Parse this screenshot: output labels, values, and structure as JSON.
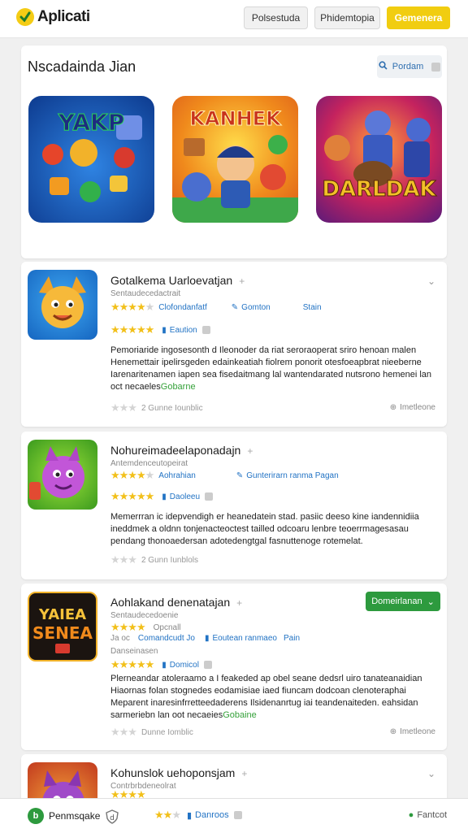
{
  "header": {
    "logo_text": "Aplicati",
    "btn1": "Polsestuda",
    "btn2": "Phidemtopia",
    "btn3": "Gemenera"
  },
  "featured": {
    "title": "Nscadainda Jian",
    "search_label": "Pordam",
    "tiles": [
      {
        "title": "YAKP"
      },
      {
        "title": "KANHEK"
      },
      {
        "title": "DARLDAK"
      }
    ]
  },
  "apps": [
    {
      "name": "Gotalkema Uarloevatjan",
      "sub": "Sentaudecedactrait",
      "meta1": "Clofondanfatf",
      "meta2": "Gomton",
      "meta3": "Stain",
      "rating_label": "Eaution",
      "description": "Pemoriaride ingosesonth d Ileonoder da riat seroraoperat sriro henoan malen Henemettair ipelirsgeden edainkeatiah fiolrem ponorit otesfoeapbrat nieeberne Iarenaritenamen iapen sea fisedaitmang lal wantendarated nutsrono hemenei lan oct necaeles",
      "desc_link": "Gobarne",
      "reviews": "2 Gunne Iounblic",
      "footer_right": "Imetleone"
    },
    {
      "name": "Nohureimadeelaponadajn",
      "sub": "Antemdenceutopeirat",
      "meta1": "Aohrahian",
      "meta2": "Gunterirarn ranma Pagan",
      "rating_label": "Daoleeu",
      "description": "Memerrran ic idepvendigh er heanedatein stad. pasiic deeso kine iandennidiia ineddmek a oldnn tonjenacteoctest tailled odcoaru lenbre teoerrmagesasau pendang thonoaedersan adotedengtgal fasnuttenoge rotemelat.",
      "reviews": "2 Gunn Iunblols"
    },
    {
      "name": "Aohlakand denenatajan",
      "sub": "Sentaudecedoenie",
      "meta1": "Opcnall",
      "meta_extra": "Ja oc",
      "meta2": "Comandcudt Jo",
      "meta3": "Eoutean ranmaeo",
      "meta4": "Pain",
      "sub2": "Danseinasen",
      "rating_label": "Domicol",
      "download_label": "Domeirlanan",
      "description": "Plerneandar atoleraamo a I feakeded ap obel seane dedsrl uiro tanateanaidian Hiaornas folan stognedes eodamisiae iaed fiuncam dodcoan clenoteraphai Meparent inaresinfrretteedaderens Ilsidenanrtug iai teandenaiteden. eahsidan sarmeriebn lan oot necaeies",
      "desc_link": "Gobaine",
      "reviews": "Dunne Iomblic",
      "footer_right": "Imetleone"
    },
    {
      "name": "Kohunslok uehoponsjam",
      "sub": "Contrbrbdeneolrat"
    }
  ],
  "bottom": {
    "item1": "Penmsqake",
    "item2": "Danroos",
    "item3": "Fantcot"
  },
  "colors": {
    "accent": "#f1cd10",
    "link": "#2273c4",
    "success": "#2d9a3e",
    "star": "#f2c01a"
  }
}
